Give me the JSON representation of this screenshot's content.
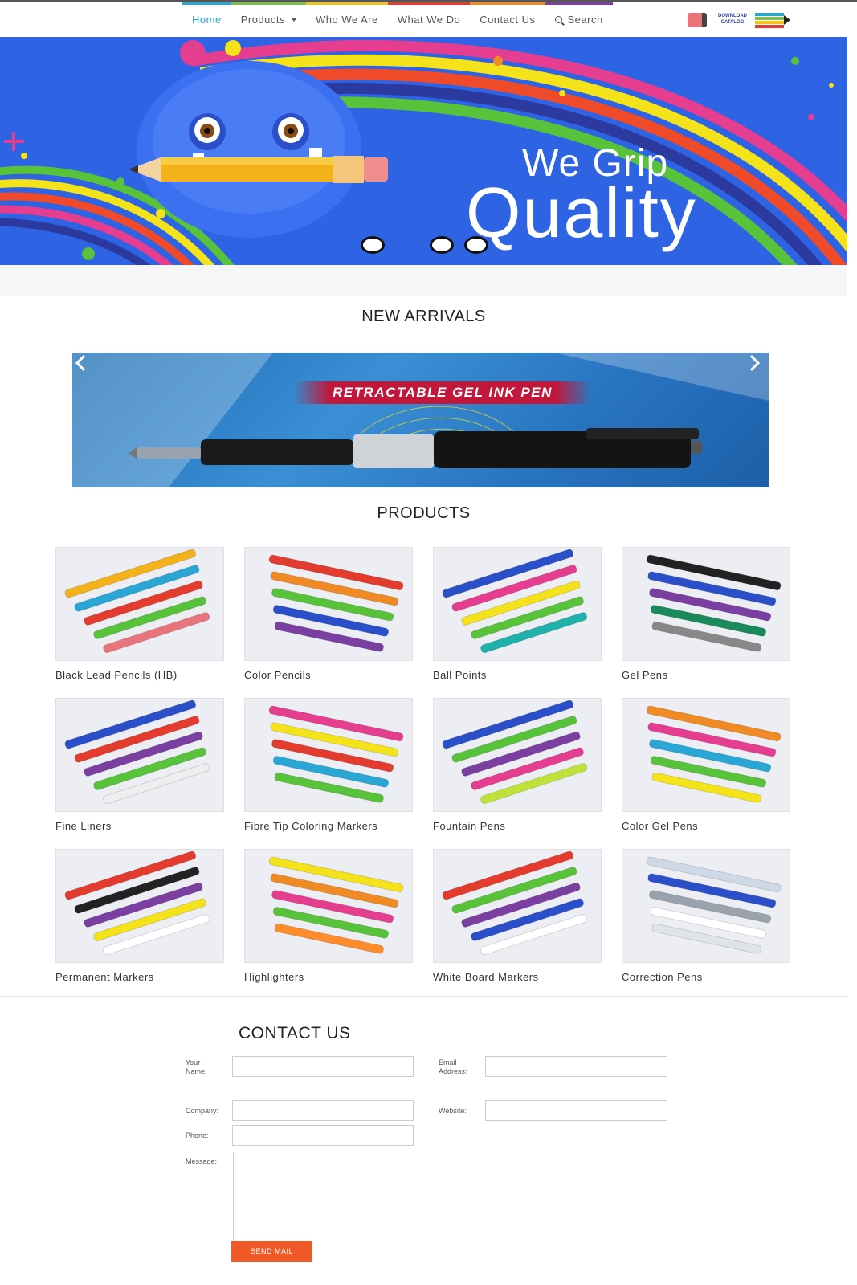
{
  "nav": {
    "items": [
      {
        "label": "Home",
        "active": true,
        "bar_color": "#2aa6d5"
      },
      {
        "label": "Products",
        "has_dropdown": true,
        "bar_color": "#7cc143"
      },
      {
        "label": "Who We Are",
        "bar_color": "#f2c41b"
      },
      {
        "label": "What We Do",
        "bar_color": "#e33b2e"
      },
      {
        "label": "Contact Us",
        "bar_color": "#f08a24"
      },
      {
        "label": "Search",
        "icon": "search-icon",
        "bar_color": "#7a3fa0"
      }
    ],
    "catalog_label": "DOWNLOAD CATALOG"
  },
  "hero": {
    "tagline_small": "We Grip",
    "tagline_large": "Quality",
    "slides": 3,
    "active_slide": 1
  },
  "new_arrivals": {
    "title": "NEW ARRIVALS",
    "banner_title": "RETRACTABLE GEL INK PEN"
  },
  "products": {
    "title": "PRODUCTS",
    "items": [
      {
        "name": "Black Lead Pencils (HB)",
        "icon": "pencil-cup-image"
      },
      {
        "name": "Color Pencils",
        "icon": "color-pencils-image"
      },
      {
        "name": "Ball Points",
        "icon": "ball-points-image"
      },
      {
        "name": "Gel Pens",
        "icon": "gel-pens-image"
      },
      {
        "name": "Fine Liners",
        "icon": "fine-liners-image"
      },
      {
        "name": "Fibre Tip Coloring Markers",
        "icon": "fibre-markers-image"
      },
      {
        "name": "Fountain Pens",
        "icon": "fountain-pens-image"
      },
      {
        "name": "Color Gel Pens",
        "icon": "color-gel-pens-image"
      },
      {
        "name": "Permanent Markers",
        "icon": "permanent-markers-image"
      },
      {
        "name": "Highlighters",
        "icon": "highlighters-image"
      },
      {
        "name": "White Board Markers",
        "icon": "whiteboard-markers-image"
      },
      {
        "name": "Correction Pens",
        "icon": "correction-pens-image"
      }
    ]
  },
  "contact": {
    "title": "CONTACT US",
    "name_label_1": "Your",
    "name_label_2": "Name:",
    "email_label_1": "Email",
    "email_label_2": "Address:",
    "company_label": "Company:",
    "website_label": "Website:",
    "phone_label": "Phone:",
    "message_label": "Message:",
    "send_label": "SEND MAIL"
  },
  "colors": {
    "accent": "#2aa6d5",
    "send_button": "#f05a28",
    "hero_bg": "#2e63e3"
  }
}
